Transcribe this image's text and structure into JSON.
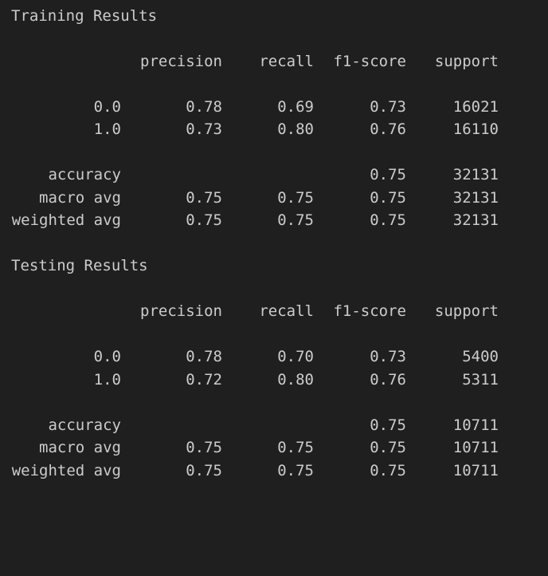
{
  "headers": {
    "precision": "precision",
    "recall": "recall",
    "f1": "f1-score",
    "support": "support"
  },
  "training": {
    "title": "Training Results",
    "rows": [
      {
        "label": "0.0",
        "precision": "0.78",
        "recall": "0.69",
        "f1": "0.73",
        "support": "16021"
      },
      {
        "label": "1.0",
        "precision": "0.73",
        "recall": "0.80",
        "f1": "0.76",
        "support": "16110"
      }
    ],
    "accuracy": {
      "label": "accuracy",
      "f1": "0.75",
      "support": "32131"
    },
    "macro": {
      "label": "macro avg",
      "precision": "0.75",
      "recall": "0.75",
      "f1": "0.75",
      "support": "32131"
    },
    "weighted": {
      "label": "weighted avg",
      "precision": "0.75",
      "recall": "0.75",
      "f1": "0.75",
      "support": "32131"
    }
  },
  "testing": {
    "title": "Testing Results",
    "rows": [
      {
        "label": "0.0",
        "precision": "0.78",
        "recall": "0.70",
        "f1": "0.73",
        "support": "5400"
      },
      {
        "label": "1.0",
        "precision": "0.72",
        "recall": "0.80",
        "f1": "0.76",
        "support": "5311"
      }
    ],
    "accuracy": {
      "label": "accuracy",
      "f1": "0.75",
      "support": "10711"
    },
    "macro": {
      "label": "macro avg",
      "precision": "0.75",
      "recall": "0.75",
      "f1": "0.75",
      "support": "10711"
    },
    "weighted": {
      "label": "weighted avg",
      "precision": "0.75",
      "recall": "0.75",
      "f1": "0.75",
      "support": "10711"
    }
  }
}
